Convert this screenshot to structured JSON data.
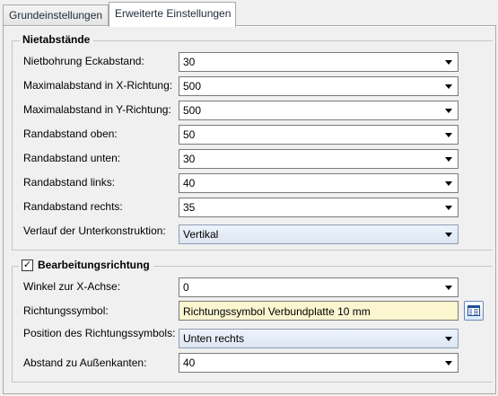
{
  "tabs": [
    {
      "label": "Grundeinstellungen",
      "active": false
    },
    {
      "label": "Erweiterte Einstellungen",
      "active": true
    }
  ],
  "groups": {
    "nietabstaende": {
      "title": "Nietabstände",
      "rows": [
        {
          "label": "Nietbohrung Eckabstand:",
          "value": "30"
        },
        {
          "label": "Maximalabstand in X-Richtung:",
          "value": "500"
        },
        {
          "label": "Maximalabstand in Y-Richtung:",
          "value": "500"
        },
        {
          "label": "Randabstand oben:",
          "value": "50"
        },
        {
          "label": "Randabstand unten:",
          "value": "30"
        },
        {
          "label": "Randabstand links:",
          "value": "40"
        },
        {
          "label": "Randabstand rechts:",
          "value": "35"
        },
        {
          "label": "Verlauf der Unterkonstruktion:",
          "value": "Vertikal"
        }
      ]
    },
    "bearbeitungsrichtung": {
      "title": "Bearbeitungsrichtung",
      "checked": true,
      "rows": [
        {
          "label": "Winkel zur X-Achse:",
          "value": "0"
        },
        {
          "label": "Richtungssymbol:",
          "value": "Richtungssymbol Verbundplatte 10 mm"
        },
        {
          "label": "Position des Richtungssymbols:",
          "value": "Unten rechts"
        },
        {
          "label": "Abstand zu Außenkanten:",
          "value": "40"
        }
      ]
    }
  },
  "icons": {
    "dropdown": "chevron-down-icon",
    "symbol_picker": "table-list-icon"
  },
  "colors": {
    "yellow_field": "#fbf6d0",
    "dropdown_field": "#dce6f2"
  }
}
